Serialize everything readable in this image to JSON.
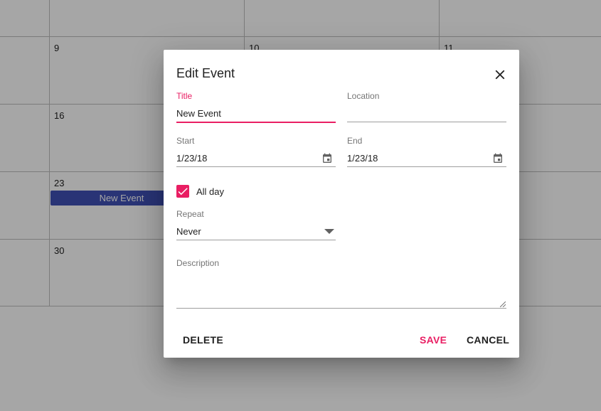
{
  "calendar": {
    "days": [
      "9",
      "10",
      "11",
      "16",
      "23",
      "30"
    ],
    "event_label": "New Event"
  },
  "dialog": {
    "title": "Edit Event",
    "title_field": {
      "label": "Title",
      "value": "New Event"
    },
    "location_field": {
      "label": "Location",
      "value": ""
    },
    "start_field": {
      "label": "Start",
      "value": "1/23/18"
    },
    "end_field": {
      "label": "End",
      "value": "1/23/18"
    },
    "all_day": {
      "label": "All day",
      "checked": true
    },
    "repeat_field": {
      "label": "Repeat",
      "value": "Never"
    },
    "description_field": {
      "label": "Description",
      "value": ""
    },
    "buttons": {
      "delete": "DELETE",
      "save": "SAVE",
      "cancel": "CANCEL"
    }
  },
  "colors": {
    "accent": "#e91e63",
    "event": "#3f51b5",
    "overlay": "rgba(0,0,0,0.35)"
  },
  "icons": [
    "close-icon",
    "calendar-icon",
    "dropdown-arrow-icon",
    "checkmark-icon"
  ]
}
